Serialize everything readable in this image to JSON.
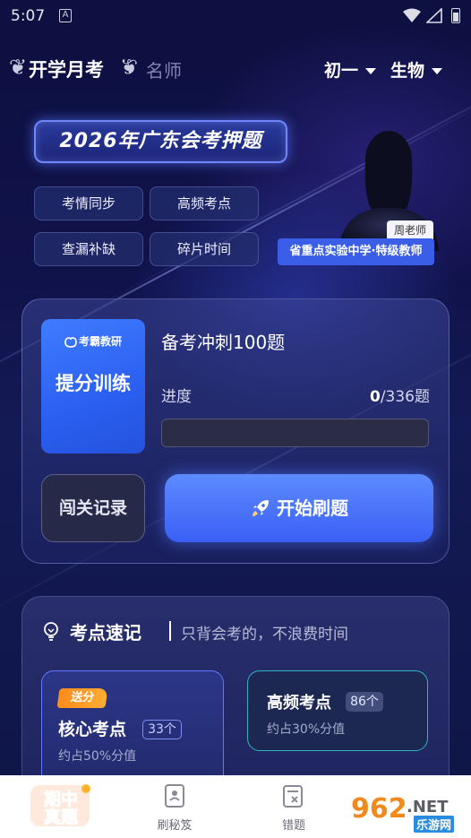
{
  "status_bar": {
    "time": "5:07",
    "notification_icon": "A"
  },
  "header": {
    "tab_active": "开学月考",
    "tab_inactive": "名师",
    "grade": "初一",
    "subject": "生物"
  },
  "promo": {
    "title": "2026年广东会考押题",
    "chips": [
      "考情同步",
      "高频考点",
      "查漏补缺",
      "碎片时间"
    ],
    "teacher_name": "周老师",
    "teacher_title": "省重点实验中学·特级教师"
  },
  "practice": {
    "badge_brand": "考霸教研",
    "badge_text": "提分训练",
    "title": "备考冲刺100题",
    "progress_label": "进度",
    "progress_done": "0",
    "progress_total": "/336题",
    "progress_fraction": 0,
    "record_button": "闯关记录",
    "start_button": "开始刷题"
  },
  "points": {
    "title": "考点速记",
    "subtitle": "只背会考的，不浪费时间",
    "cards": [
      {
        "ribbon": "送分",
        "name": "核心考点",
        "count": "33个",
        "sub": "约占50%分值"
      },
      {
        "name": "高频考点",
        "count": "86个",
        "sub": "约占30%分值"
      }
    ]
  },
  "bottom_nav": {
    "logo_text": "期中真题",
    "items": [
      {
        "label": "刷秘笈",
        "icon": "book-icon"
      },
      {
        "label": "错题",
        "icon": "mistake-icon"
      }
    ],
    "watermark": "962.NET",
    "watermark_sub": "乐游网"
  },
  "colors": {
    "accent": "#3a5ff5",
    "teal": "#2fb5c0",
    "orange": "#ff8a1d",
    "background": "#0d1040"
  }
}
